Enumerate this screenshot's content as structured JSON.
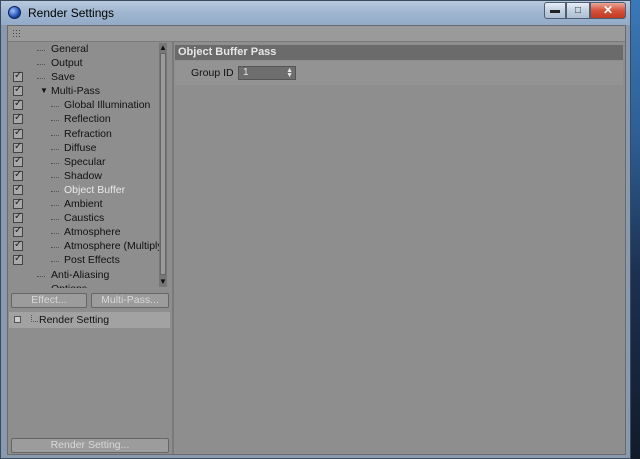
{
  "window": {
    "title": "Render Settings",
    "controls": {
      "minimize": "▬",
      "maximize": "□",
      "close": "✕"
    }
  },
  "tree": {
    "items": [
      {
        "label": "General",
        "checked": false,
        "indent": 0
      },
      {
        "label": "Output",
        "checked": false,
        "indent": 0
      },
      {
        "label": "Save",
        "checked": true,
        "indent": 0
      },
      {
        "label": "Multi-Pass",
        "checked": true,
        "indent": 0,
        "expanded": true
      },
      {
        "label": "Global Illumination",
        "checked": true,
        "indent": 1
      },
      {
        "label": "Reflection",
        "checked": true,
        "indent": 1
      },
      {
        "label": "Refraction",
        "checked": true,
        "indent": 1
      },
      {
        "label": "Diffuse",
        "checked": true,
        "indent": 1
      },
      {
        "label": "Specular",
        "checked": true,
        "indent": 1
      },
      {
        "label": "Shadow",
        "checked": true,
        "indent": 1
      },
      {
        "label": "Object Buffer",
        "checked": true,
        "indent": 1,
        "selected": true
      },
      {
        "label": "Ambient",
        "checked": true,
        "indent": 1
      },
      {
        "label": "Caustics",
        "checked": true,
        "indent": 1
      },
      {
        "label": "Atmosphere",
        "checked": true,
        "indent": 1
      },
      {
        "label": "Atmosphere (Multiply)",
        "checked": true,
        "indent": 1
      },
      {
        "label": "Post Effects",
        "checked": true,
        "indent": 1
      },
      {
        "label": "Anti-Aliasing",
        "checked": false,
        "indent": 0
      },
      {
        "label": "Options",
        "checked": false,
        "indent": 0
      }
    ]
  },
  "buttons": {
    "effect": "Effect...",
    "multipass": "Multi-Pass...",
    "render_setting": "Render Setting..."
  },
  "render_list": {
    "item": "Render Setting"
  },
  "panel": {
    "title": "Object Buffer Pass",
    "group_id_label": "Group ID",
    "group_id_value": "1"
  }
}
